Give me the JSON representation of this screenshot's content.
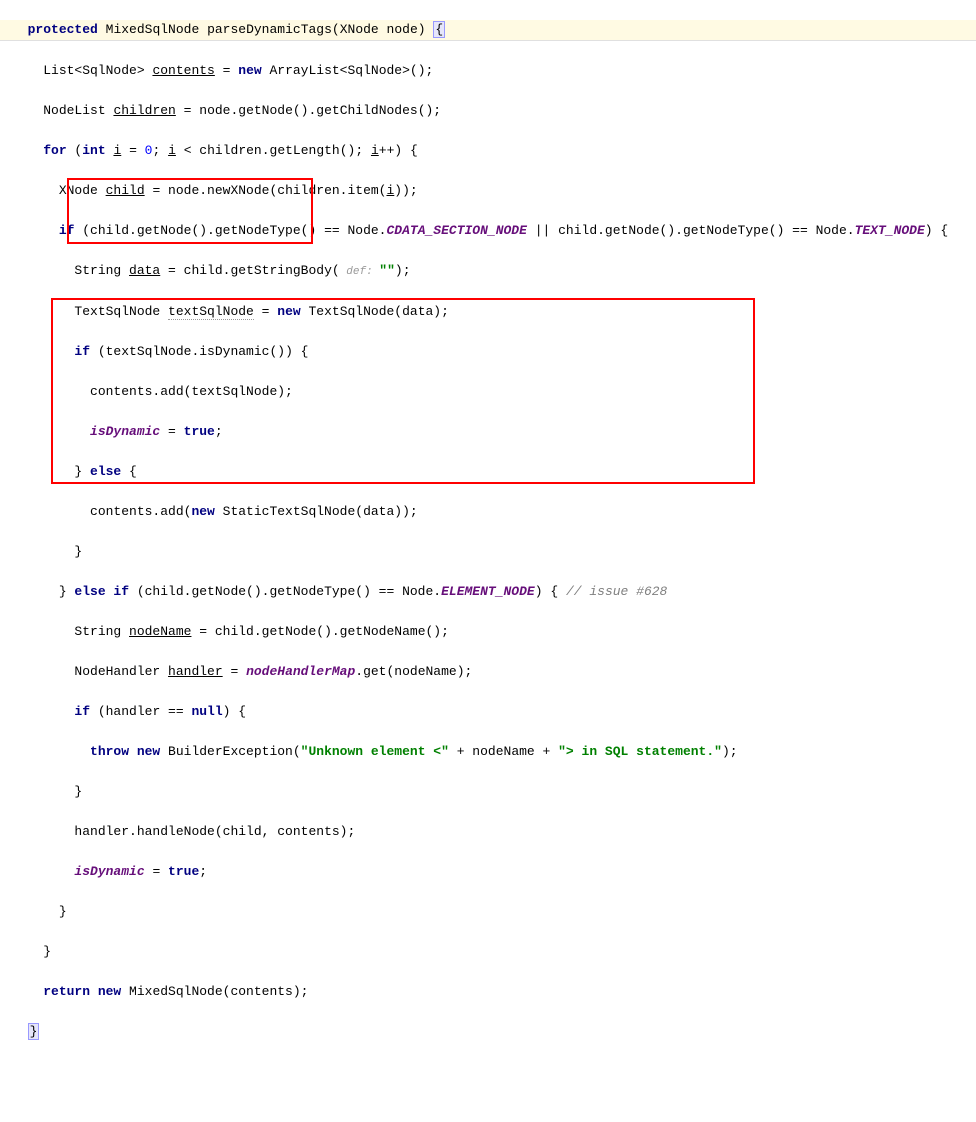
{
  "code": {
    "line1": {
      "kw1": "protected",
      "type": "MixedSqlNode",
      "method": "parseDynamicTags",
      "param_type": "XNode",
      "param_name": "node",
      "brace": "{"
    },
    "line2": {
      "text1": "List<SqlNode> ",
      "var": "contents",
      "text2": " = ",
      "kw": "new",
      "text3": " ArrayList<SqlNode>();"
    },
    "line3": {
      "text1": "NodeList ",
      "var": "children",
      "text2": " = ",
      "call": "node.getNode().getChildNodes();"
    },
    "line4": {
      "kw1": "for",
      "text1": " (",
      "kw2": "int",
      "text2": " ",
      "var1": "i",
      "text3": " = ",
      "num": "0",
      "text4": "; ",
      "var2": "i",
      "text5": " < children.getLength(); ",
      "var3": "i",
      "text6": "++) {"
    },
    "line5": {
      "text1": "XNode ",
      "var": "child",
      "text2": " = node.newXNode(children.item(",
      "var2": "i",
      "text3": "));"
    },
    "line6": {
      "kw1": "if",
      "text1": " (child.getNode().getNodeType() == Node.",
      "const1": "CDATA_SECTION_NODE",
      "text2": " || child.getNode().getNodeType() == Node.",
      "const2": "TEXT_NODE",
      "text3": ") {"
    },
    "line7": {
      "text1": "String ",
      "var": "data",
      "text2": " = child.getStringBody(",
      "hint": " def: ",
      "str": "\"\"",
      "text3": ");"
    },
    "line8": {
      "text1": "TextSqlNode ",
      "var": "textSqlNode",
      "text2": " = ",
      "kw": "new",
      "text3": " TextSqlNode(data);"
    },
    "line9": {
      "kw": "if",
      "text": " (textSqlNode.isDynamic()) {"
    },
    "line10": {
      "text": "contents.add(textSqlNode);"
    },
    "line11": {
      "var": "isDynamic",
      "text1": " = ",
      "kw": "true",
      "text2": ";"
    },
    "line12": {
      "text": "} ",
      "kw": "else",
      "text2": " {"
    },
    "line13": {
      "text1": "contents.add(",
      "kw": "new",
      "text2": " StaticTextSqlNode(data));"
    },
    "line14": {
      "text": "}"
    },
    "line15": {
      "text1": "} ",
      "kw1": "else if",
      "text2": " (child.getNode().getNodeType() == Node.",
      "const": "ELEMENT_NODE",
      "text3": ") { ",
      "comment": "// issue #628"
    },
    "line16": {
      "text1": "String ",
      "var": "nodeName",
      "text2": " = child.getNode().getNodeName();"
    },
    "line17": {
      "text1": "NodeHandler ",
      "var": "handler",
      "text2": " = ",
      "field": "nodeHandlerMap",
      "text3": ".get(nodeName);"
    },
    "line18": {
      "kw1": "if",
      "text1": " (handler == ",
      "kw2": "null",
      "text2": ") {"
    },
    "line19": {
      "kw1": "throw new",
      "text1": " BuilderException(",
      "str1": "\"Unknown element <\"",
      "text2": " + nodeName + ",
      "str2": "\"> in SQL statement.\"",
      "text3": ");"
    },
    "line20": {
      "text": "}"
    },
    "line21": {
      "text": "handler.handleNode(child, contents);"
    },
    "line22": {
      "var": "isDynamic",
      "text1": " = ",
      "kw": "true",
      "text2": ";"
    },
    "line23": {
      "text": "}"
    },
    "line24": {
      "text": "}"
    },
    "line25": {
      "kw1": "return new",
      "text": " MixedSqlNode(contents);"
    },
    "line26": {
      "brace": "}"
    }
  }
}
